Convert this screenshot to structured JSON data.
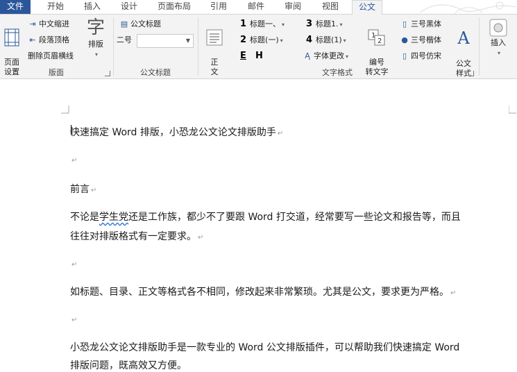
{
  "tabs": [
    {
      "label": "文件"
    },
    {
      "label": "开始"
    },
    {
      "label": "插入"
    },
    {
      "label": "设计"
    },
    {
      "label": "页面布局"
    },
    {
      "label": "引用"
    },
    {
      "label": "邮件"
    },
    {
      "label": "审阅"
    },
    {
      "label": "视图"
    },
    {
      "label": "公文"
    }
  ],
  "ribbon": {
    "layout_group": {
      "page_setup": "页面\n设置",
      "cn_indent": "中文缩进",
      "para_top": "段落顶格",
      "del_header_line": "删除页眉横线",
      "typeset": "排版",
      "label": "版面"
    },
    "title_group": {
      "doc_title": "公文标题",
      "size_label": "二号",
      "size_value": "",
      "label": "公文标题"
    },
    "format_group": {
      "body_text": "正\n文",
      "h1": "标题一、",
      "h2": "标题(一)",
      "h3": "标题1.",
      "h4": "标题(1)",
      "e_btn": "E",
      "h_btn": "H",
      "font_change": "字体更改",
      "number_convert": "编号\n转文字",
      "font_black": "三号黑体",
      "font_kai": "三号楷体",
      "font_fangsong": "四号仿宋",
      "doc_style": "公文\n样式",
      "label": "文字格式",
      "n1": "1",
      "n2": "2",
      "n3": "3",
      "n4": "4"
    },
    "insert_group": {
      "insert": "插入"
    }
  },
  "document": {
    "p1": "快速搞定 Word 排版，小恐龙公文论文排版助手",
    "p3": "前言",
    "p4_a": "不论是",
    "p4_b": "学生党",
    "p4_c": "还是工作族，都少不了要跟 Word 打交道，经常要写一些论文和报告等，而且",
    "p4_line2": "往往对排版格式有一定要求。",
    "p6": "如标题、目录、正文等格式各不相同，修改起来非常繁琐。尤其是公文，要求更为严格。",
    "p8": "小恐龙公文论文排版助手是一款专业的 Word 公文排版插件，可以帮助我们快速搞定 Word",
    "p8_line2": "排版问题，既高效又方便。",
    "para_mark": "↵"
  },
  "colors": {
    "accent": "#2b579a",
    "ribbon_bg": "#f3f3f3"
  }
}
